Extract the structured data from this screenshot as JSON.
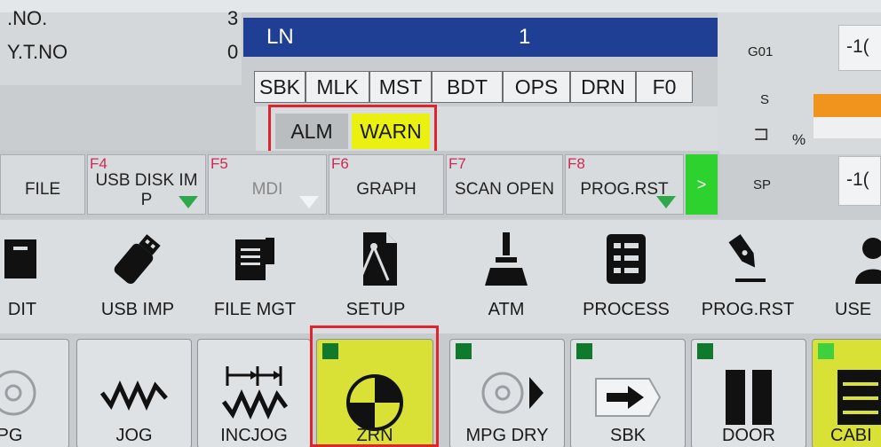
{
  "top_left": {
    "rows": [
      {
        "label": ".NO.",
        "value": "3"
      },
      {
        "label": "Y.T.NO",
        "value": "0"
      }
    ]
  },
  "ln_bar": {
    "label": "LN",
    "value": "1"
  },
  "mode_keys": [
    "SBK",
    "MLK",
    "MST",
    "BDT",
    "OPS",
    "DRN",
    "F0"
  ],
  "alarm": {
    "alm_label": "ALM",
    "warn_label": "WARN"
  },
  "right_panel": {
    "g_code": "G01",
    "g_value": "-1(",
    "s_label": "S",
    "percent": "%",
    "sp_label": "SP",
    "sp_value": "-1("
  },
  "function_keys": [
    {
      "num": "",
      "label": "FILE",
      "arrow": false
    },
    {
      "num": "F4",
      "label": "USB DISK IM\nP",
      "arrow": true
    },
    {
      "num": "F5",
      "label": "MDI",
      "arrow": true
    },
    {
      "num": "F6",
      "label": "GRAPH",
      "arrow": false
    },
    {
      "num": "F7",
      "label": "SCAN OPEN",
      "arrow": false
    },
    {
      "num": "F8",
      "label": "PROG.RST",
      "arrow": true
    }
  ],
  "next_key": ">",
  "tools": [
    {
      "label": "DIT",
      "icon": "edit-icon"
    },
    {
      "label": "USB IMP",
      "icon": "usb-drive-icon"
    },
    {
      "label": "FILE MGT",
      "icon": "file-manager-icon"
    },
    {
      "label": "SETUP",
      "icon": "setup-compass-icon"
    },
    {
      "label": "ATM",
      "icon": "probe-icon"
    },
    {
      "label": "PROCESS",
      "icon": "process-list-icon"
    },
    {
      "label": "PROG.RST",
      "icon": "pen-nib-icon"
    },
    {
      "label": "USE",
      "icon": "user-switch-icon"
    }
  ],
  "mode_buttons": [
    {
      "label": "IPG",
      "icon": "handwheel-icon",
      "active": false
    },
    {
      "label": "JOG",
      "icon": "zigzag-icon",
      "active": false
    },
    {
      "label": "INCJOG",
      "icon": "increment-jog-icon",
      "active": false
    },
    {
      "label": "ZRN",
      "icon": "home-return-icon",
      "active": true
    },
    {
      "label": "MPG DRY",
      "icon": "handwheel-dry-icon",
      "active": false
    },
    {
      "label": "SBK",
      "icon": "single-block-arrow-icon",
      "active": false
    },
    {
      "label": "DOOR",
      "icon": "door-icon",
      "active": false
    },
    {
      "label": "CABI",
      "icon": "cabinet-icon",
      "active": true
    }
  ],
  "colors": {
    "ln_bar": "#1f3f95",
    "warn": "#eaf00f",
    "active_button": "#d9e136",
    "led_on": "#107a2c",
    "highlight_box": "#e0242b",
    "next_key": "#2ed22e"
  }
}
